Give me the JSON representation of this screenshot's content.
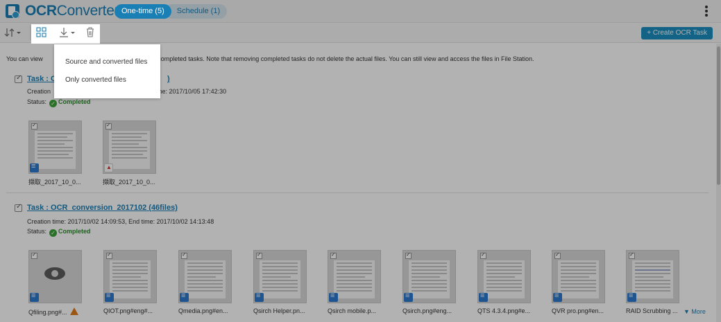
{
  "header": {
    "app_title_bold": "OCR",
    "app_title_light": "Converter",
    "tabs": [
      {
        "label": "One-time (5)",
        "active": true
      },
      {
        "label": "Schedule (1)",
        "active": false
      }
    ]
  },
  "toolbar": {
    "create_label": "+ Create OCR Task"
  },
  "download_menu": {
    "items": [
      "Source and converted files",
      "Only converted files"
    ]
  },
  "notice": "You can view … the completed tasks. Note that removing completed tasks do not delete the actual files. You can still view and access the files in File Station.",
  "notice_left": "You can view",
  "notice_right": "he completed tasks. Note that removing completed tasks do not delete the actual files. You can still view and access the files in File Station.",
  "tasks": [
    {
      "title": "Task : C",
      "title_tail": ")",
      "meta_left": "Creation",
      "meta_right": "me: 2017/10/05 17:42:30",
      "status_label": "Status:",
      "status": "Completed",
      "files": [
        {
          "name": "擷取_2017_10_0...",
          "type": "txt"
        },
        {
          "name": "擷取_2017_10_0...",
          "type": "pdf"
        }
      ]
    },
    {
      "title": "Task : OCR_conversion_2017102",
      "count": "(46files)",
      "meta": "Creation time: 2017/10/02 14:09:53, End time: 2017/10/02 14:13:48",
      "status_label": "Status:",
      "status": "Completed",
      "files": [
        {
          "name": "Qfiling.png#...",
          "type": "txt",
          "warning": true
        },
        {
          "name": "QIOT.png#eng#...",
          "type": "txt"
        },
        {
          "name": "Qmedia.png#en...",
          "type": "txt"
        },
        {
          "name": "Qsirch Helper.pn...",
          "type": "txt"
        },
        {
          "name": "Qsirch mobile.p...",
          "type": "txt"
        },
        {
          "name": "Qsirch.png#eng...",
          "type": "txt"
        },
        {
          "name": "QTS 4.3.4.png#e...",
          "type": "txt"
        },
        {
          "name": "QVR pro.png#en...",
          "type": "txt"
        },
        {
          "name": "RAID Scrubbing ...",
          "type": "txt"
        }
      ],
      "more_label": "▼ More"
    }
  ],
  "colors": {
    "accent": "#1a7fb5",
    "success": "#3da23a",
    "warning": "#e07b1a"
  },
  "icons": [
    "sort-icon",
    "select-all-icon",
    "download-icon",
    "trash-icon",
    "kebab-menu-icon",
    "check-circle-icon",
    "warning-icon",
    "eye-icon",
    "text-file-icon",
    "pdf-file-icon"
  ]
}
